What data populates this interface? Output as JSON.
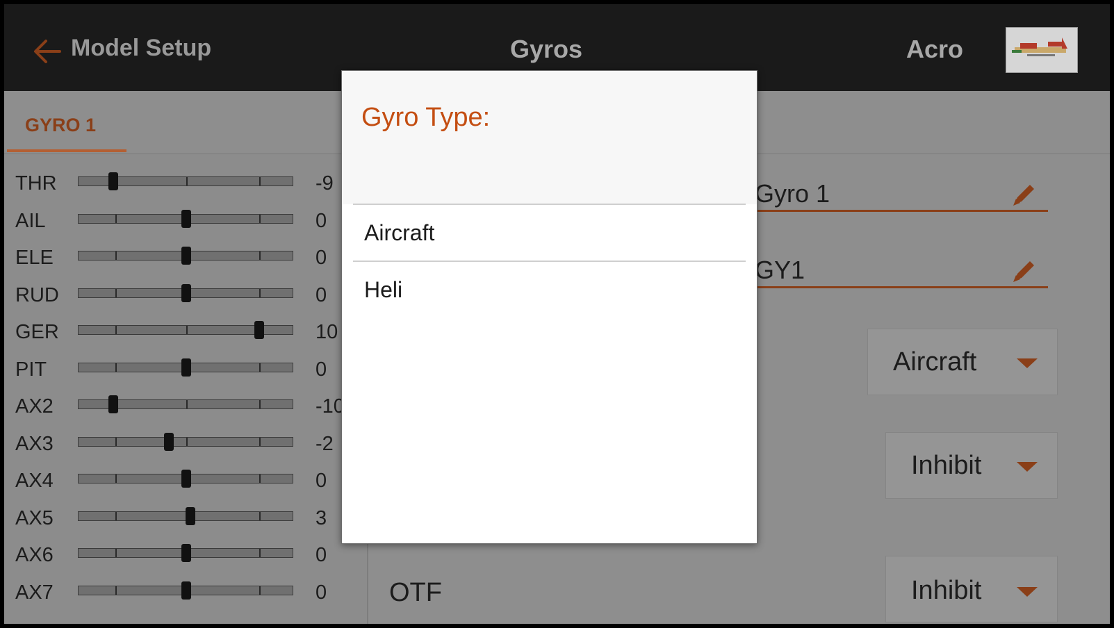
{
  "header": {
    "back_label": "Model Setup",
    "title": "Gyros",
    "model_name": "Acro"
  },
  "tabs": [
    {
      "label": "GYRO 1",
      "active": true
    }
  ],
  "monitor": {
    "channels": [
      {
        "label": "THR",
        "value": "-9",
        "level": 0.16
      },
      {
        "label": "AIL",
        "value": "0",
        "level": 0.5
      },
      {
        "label": "ELE",
        "value": "0",
        "level": 0.5
      },
      {
        "label": "RUD",
        "value": "0",
        "level": 0.5
      },
      {
        "label": "GER",
        "value": "10",
        "level": 0.84
      },
      {
        "label": "PIT",
        "value": "0",
        "level": 0.5
      },
      {
        "label": "AX2",
        "value": "-10",
        "level": 0.16
      },
      {
        "label": "AX3",
        "value": "-2",
        "level": 0.42
      },
      {
        "label": "AX4",
        "value": "0",
        "level": 0.5
      },
      {
        "label": "AX5",
        "value": "3",
        "level": 0.52
      },
      {
        "label": "AX6",
        "value": "0",
        "level": 0.5
      },
      {
        "label": "AX7",
        "value": "0",
        "level": 0.5
      }
    ]
  },
  "settings": {
    "name_value": "Gyro 1",
    "short_name_value": "GY1",
    "type_value": "Aircraft",
    "dropdown2_value": "Inhibit",
    "otf_label": "OTF",
    "otf_value": "Inhibit"
  },
  "dialog": {
    "title": "Gyro Type:",
    "options": [
      "Aircraft",
      "Heli"
    ]
  },
  "colors": {
    "accent": "#c44e12",
    "header_bg": "#1a1a1a",
    "overlay_bg": "#8c8c8c"
  }
}
